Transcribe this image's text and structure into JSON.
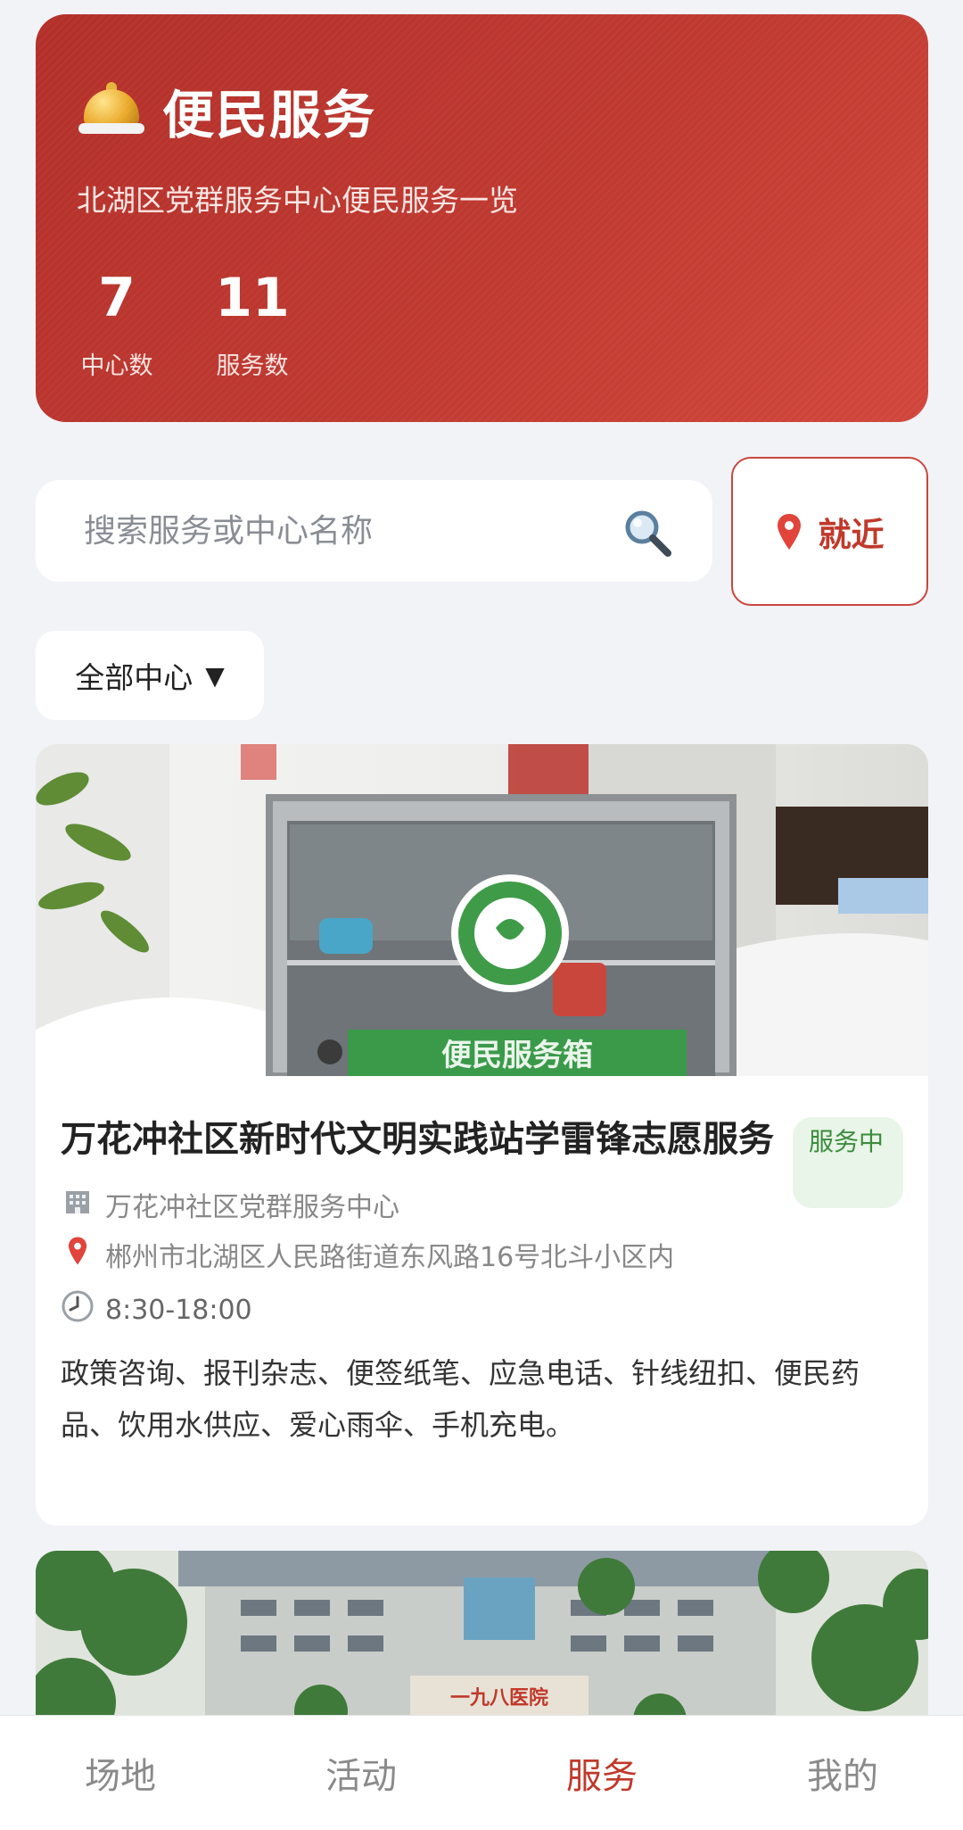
{
  "header": {
    "title": "便民服务",
    "subtitle": "北湖区党群服务中心便民服务一览",
    "stats": [
      {
        "value": "7",
        "label": "中心数"
      },
      {
        "value": "11",
        "label": "服务数"
      }
    ]
  },
  "search": {
    "placeholder": "搜索服务或中心名称",
    "nearby_label": "就近"
  },
  "filter": {
    "selected": "全部中心",
    "caret": "▼"
  },
  "services": [
    {
      "title": "万花冲社区新时代文明实践站学雷锋志愿服务",
      "status": "服务中",
      "center": "万花冲社区党群服务中心",
      "address": "郴州市北湖区人民路街道东风路16号北斗小区内",
      "hours": "8:30-18:00",
      "description": "政策咨询、报刊杂志、便签纸笔、应急电话、针线纽扣、便民药品、饮用水供应、爱心雨伞、手机充电。",
      "image": {
        "box_label": "便民服务箱",
        "emblem_label": "便民服务箱"
      }
    },
    {
      "image": {
        "sign": "一九八医院"
      }
    }
  ],
  "tabbar": {
    "items": [
      {
        "label": "场地"
      },
      {
        "label": "活动"
      },
      {
        "label": "服务"
      },
      {
        "label": "我的"
      }
    ],
    "active_index": 2
  },
  "colors": {
    "brand_red": "#c0392b",
    "badge_green": "#3d8b3d",
    "background": "#f2f3f7"
  }
}
